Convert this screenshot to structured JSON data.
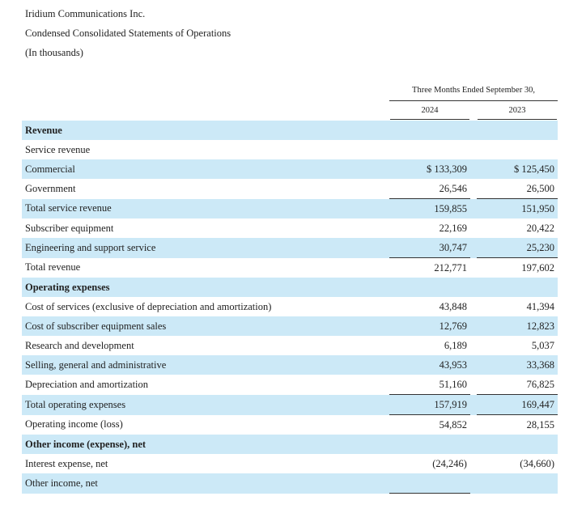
{
  "header": {
    "company": "Iridium Communications Inc.",
    "statement": "Condensed Consolidated Statements of Operations",
    "units": "(In thousands)"
  },
  "columns": {
    "period": "Three Months Ended September 30,",
    "years": [
      "2024",
      "2023"
    ]
  },
  "rows": [
    {
      "label": "Revenue",
      "type": "section",
      "values": [
        "",
        ""
      ]
    },
    {
      "label": "Service revenue",
      "type": "label",
      "values": [
        "",
        ""
      ]
    },
    {
      "label": "Commercial",
      "type": "item",
      "values": [
        "$ 133,309",
        "$ 125,450"
      ]
    },
    {
      "label": "Government",
      "type": "item",
      "values": [
        "26,546",
        "26,500"
      ],
      "underline": true
    },
    {
      "label": "Total service revenue",
      "type": "item",
      "values": [
        "159,855",
        "151,950"
      ]
    },
    {
      "label": "Subscriber equipment",
      "type": "item",
      "values": [
        "22,169",
        "20,422"
      ]
    },
    {
      "label": "Engineering and support service",
      "type": "item",
      "values": [
        "30,747",
        "25,230"
      ],
      "underline": true
    },
    {
      "label": "Total revenue",
      "type": "item",
      "values": [
        "212,771",
        "197,602"
      ]
    },
    {
      "label": "Operating expenses",
      "type": "section",
      "values": [
        "",
        ""
      ]
    },
    {
      "label": "Cost of services (exclusive of depreciation and amortization)",
      "type": "item",
      "values": [
        "43,848",
        "41,394"
      ]
    },
    {
      "label": "Cost of subscriber equipment sales",
      "type": "item",
      "values": [
        "12,769",
        "12,823"
      ]
    },
    {
      "label": "Research and development",
      "type": "item",
      "values": [
        "6,189",
        "5,037"
      ]
    },
    {
      "label": "Selling, general and administrative",
      "type": "item",
      "values": [
        "43,953",
        "33,368"
      ]
    },
    {
      "label": "Depreciation and amortization",
      "type": "item",
      "values": [
        "51,160",
        "76,825"
      ],
      "underline": true
    },
    {
      "label": "Total operating expenses",
      "type": "item",
      "values": [
        "157,919",
        "169,447"
      ],
      "underline": true
    },
    {
      "label": "Operating income (loss)",
      "type": "item",
      "values": [
        "54,852",
        "28,155"
      ]
    },
    {
      "label": "Other income (expense), net",
      "type": "section",
      "values": [
        "",
        ""
      ]
    },
    {
      "label": "Interest expense, net",
      "type": "item",
      "values": [
        "(24,246)",
        "(34,660)"
      ]
    },
    {
      "label": "Other income, net",
      "type": "item",
      "values": [
        "",
        ""
      ],
      "underline_first_only": true
    }
  ]
}
